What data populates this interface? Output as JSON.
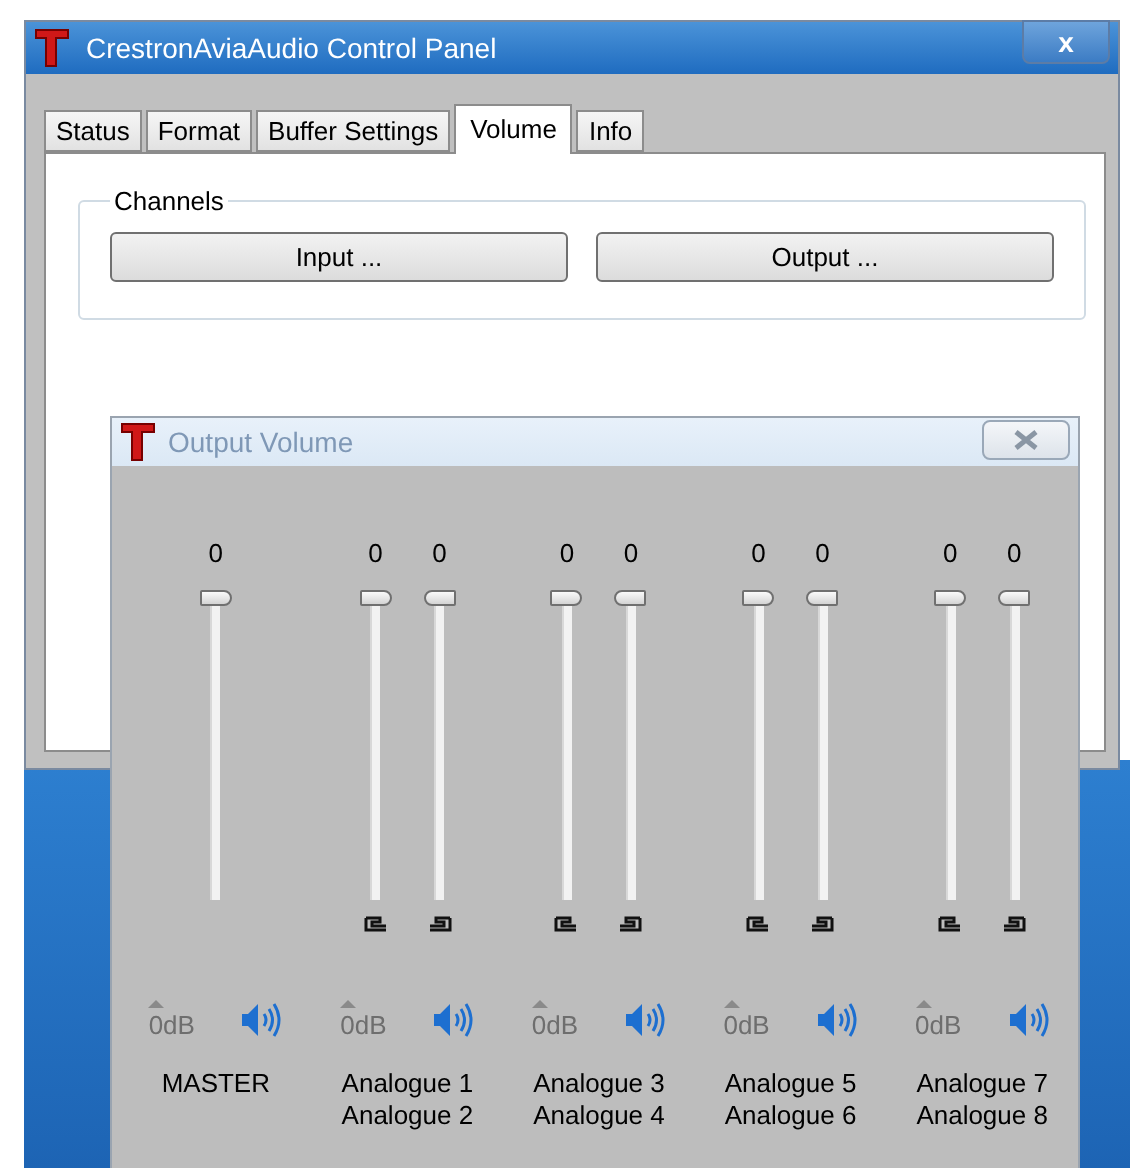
{
  "window": {
    "title": "CrestronAviaAudio Control Panel",
    "close": "x"
  },
  "tabs": [
    {
      "label": "Status",
      "selected": false
    },
    {
      "label": "Format",
      "selected": false
    },
    {
      "label": "Buffer Settings",
      "selected": false
    },
    {
      "label": "Volume",
      "selected": true
    },
    {
      "label": "Info",
      "selected": false
    }
  ],
  "channels_group": {
    "title": "Channels",
    "buttons": [
      "Input ...",
      "Output ..."
    ]
  },
  "dialog": {
    "title": "Output Volume",
    "groups": [
      {
        "labels": [
          "MASTER"
        ],
        "linked": false,
        "boost": "0dB",
        "boost_disabled": true,
        "sliders": [
          {
            "value": "0",
            "level": 1
          }
        ]
      },
      {
        "labels": [
          "Analogue 1",
          "Analogue 2"
        ],
        "linked": true,
        "boost": "0dB",
        "boost_disabled": true,
        "sliders": [
          {
            "value": "0",
            "level": 1
          },
          {
            "value": "0",
            "level": 1
          }
        ]
      },
      {
        "labels": [
          "Analogue 3",
          "Analogue 4"
        ],
        "linked": true,
        "boost": "0dB",
        "boost_disabled": true,
        "sliders": [
          {
            "value": "0",
            "level": 1
          },
          {
            "value": "0",
            "level": 1
          }
        ]
      },
      {
        "labels": [
          "Analogue 5",
          "Analogue 6"
        ],
        "linked": true,
        "boost": "0dB",
        "boost_disabled": true,
        "sliders": [
          {
            "value": "0",
            "level": 1
          },
          {
            "value": "0",
            "level": 1
          }
        ]
      },
      {
        "labels": [
          "Analogue 7",
          "Analogue 8"
        ],
        "linked": true,
        "boost": "0dB",
        "boost_disabled": true,
        "sliders": [
          {
            "value": "0",
            "level": 1
          },
          {
            "value": "0",
            "level": 1
          }
        ]
      }
    ]
  }
}
